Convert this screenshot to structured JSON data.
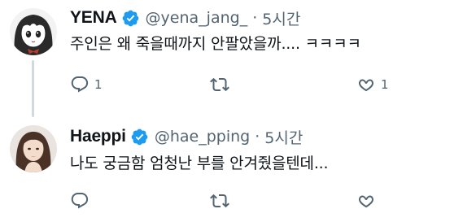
{
  "tweets": [
    {
      "author_name": "YENA",
      "handle": "@yena_jang_",
      "separator": "·",
      "time": "5시간",
      "text": "주인은 왜 죽을때까지 안팔았을까.... ㅋㅋㅋㅋ",
      "reply_count": "1",
      "retweet_count": "",
      "like_count": "1",
      "avatar": "anime-girl-avatar"
    },
    {
      "author_name": "Haeppi",
      "handle": "@hae_pping",
      "separator": "·",
      "time": "5시간",
      "text": "나도 궁금함 엄청난 부를 안겨줬을텐데...",
      "reply_count": "",
      "retweet_count": "",
      "like_count": "",
      "avatar": "photo-avatar"
    }
  ],
  "colors": {
    "verified": "#1d9bf0",
    "secondary_text": "#536471",
    "thread_line": "#cfd9de"
  },
  "icons": [
    "verified-badge-icon",
    "reply-icon",
    "retweet-icon",
    "like-icon"
  ]
}
